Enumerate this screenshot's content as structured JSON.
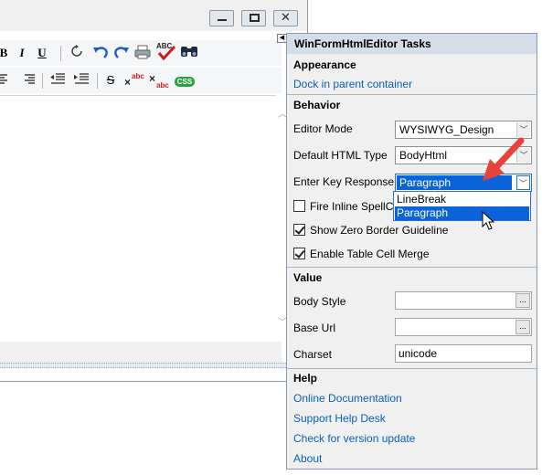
{
  "window": {
    "caption_buttons": [
      "minimize-icon",
      "maximize-icon",
      "close-icon"
    ],
    "close_glyph": "✕"
  },
  "toolbar1": {
    "bold": "B",
    "italic": "I",
    "underline": "U",
    "icons": [
      "refresh-icon",
      "undo-icon",
      "redo-icon",
      "print-icon",
      "spellcheck-icon",
      "find-icon"
    ],
    "spellcheck_text": "ABC"
  },
  "toolbar2": {
    "icons": [
      "align-left-icon",
      "align-right-icon",
      "outdent-icon",
      "indent-icon",
      "strikethrough-icon",
      "superscript-icon",
      "subscript-icon",
      "css-icon"
    ],
    "strike_text": "S",
    "sup_text": "abc",
    "sub_text": "abc",
    "css_text": "CSS"
  },
  "panel": {
    "title": "WinFormHtmlEditor Tasks",
    "sections": {
      "appearance": "Appearance",
      "behavior": "Behavior",
      "value": "Value",
      "help": "Help"
    },
    "dock_link": "Dock in parent container",
    "editor_mode_label": "Editor Mode",
    "editor_mode_value": "WYSIWYG_Design",
    "html_type_label": "Default HTML Type",
    "html_type_value": "BodyHtml",
    "enter_key_label": "Enter Key Response",
    "enter_key_value": "Paragraph",
    "enter_key_options": [
      "LineBreak",
      "Paragraph"
    ],
    "fire_spellcheck_label": "Fire Inline SpellCh",
    "fire_spellcheck_checked": false,
    "zero_border_label": "Show Zero Border Guideline",
    "zero_border_checked": true,
    "table_merge_label": "Enable Table Cell Merge",
    "table_merge_checked": true,
    "body_style_label": "Body Style",
    "body_style_value": "",
    "base_url_label": "Base Url",
    "base_url_value": "",
    "charset_label": "Charset",
    "charset_value": "unicode",
    "ellipsis": "...",
    "help_links": [
      "Online Documentation",
      "Support Help Desk",
      "Check for version update",
      "About"
    ]
  },
  "colors": {
    "accent_blue": "#0a64d8",
    "link_blue": "#0b5fb8",
    "annotation_red": "#e8433b"
  }
}
